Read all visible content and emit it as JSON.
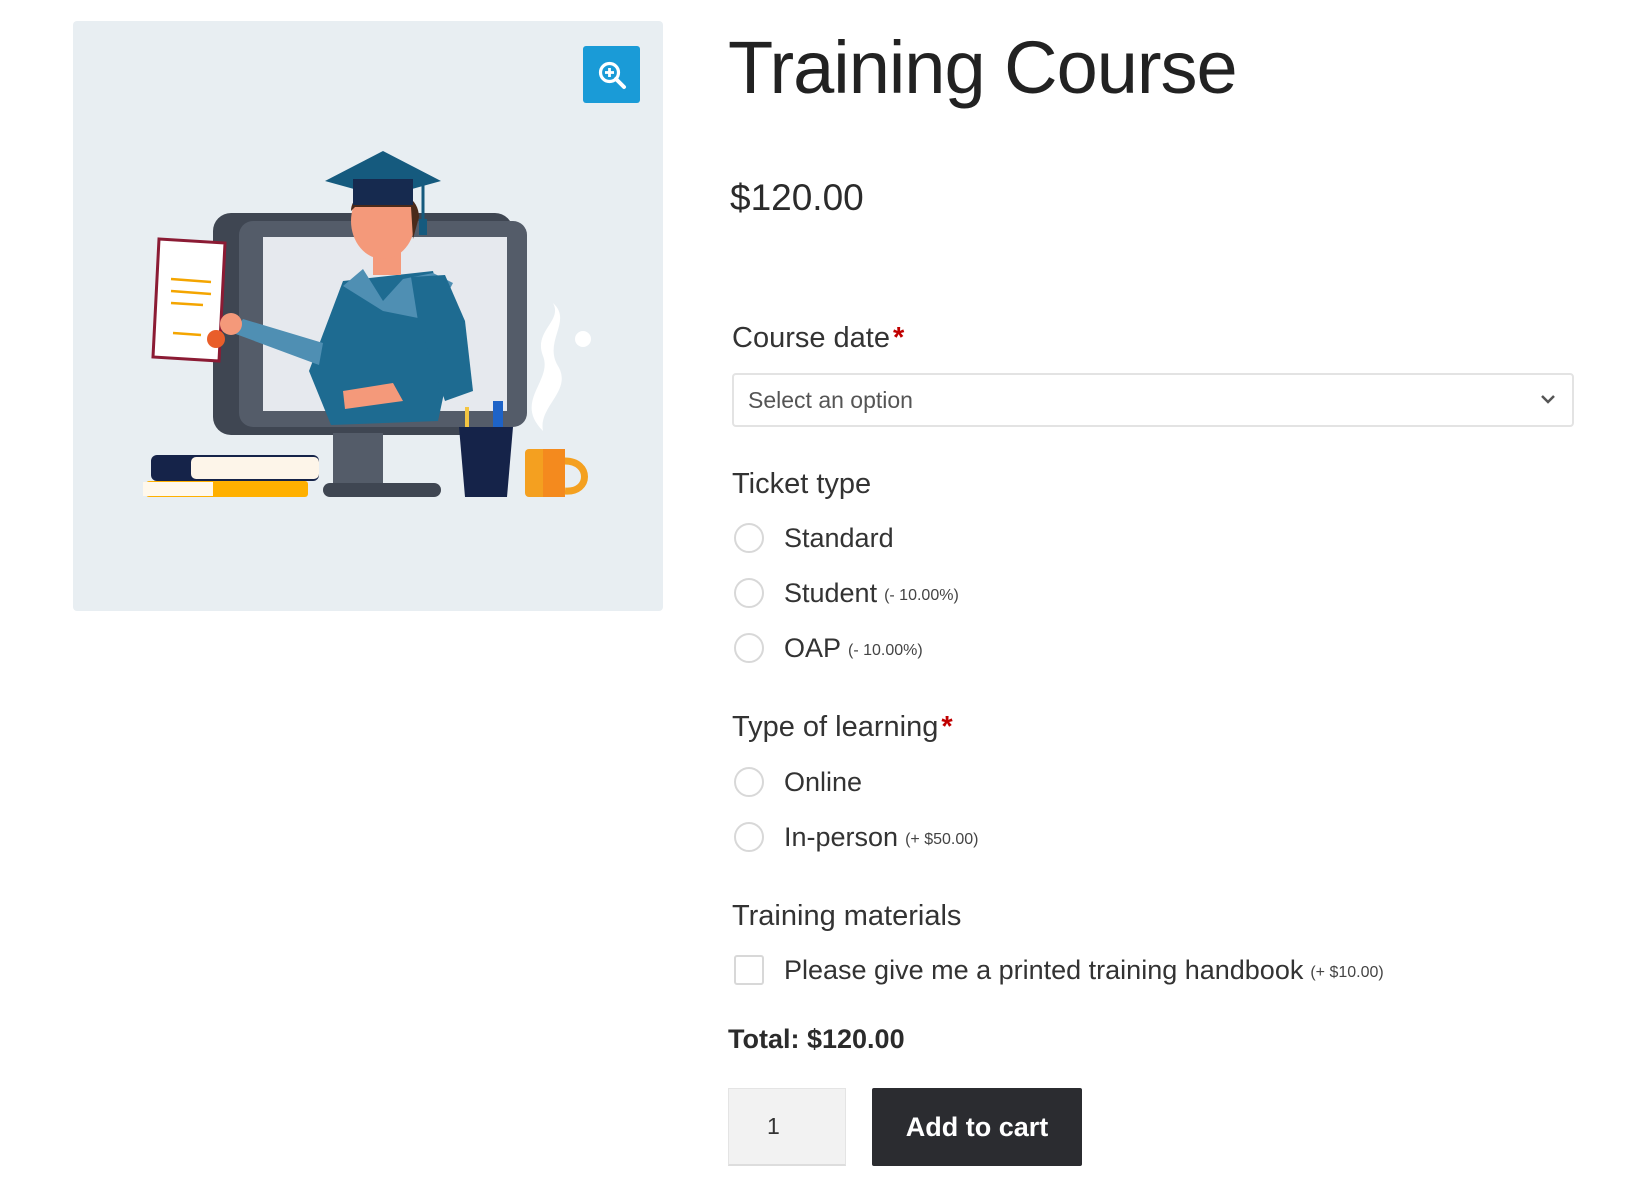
{
  "product": {
    "zoom_icon": "magnifier-plus-icon",
    "title": "Training Course",
    "price": "$120.00"
  },
  "course_date": {
    "label": "Course date",
    "required_mark": "*",
    "selected": "Select an option",
    "chevron_icon": "chevron-down-icon"
  },
  "ticket_type": {
    "label": "Ticket type",
    "options": [
      {
        "label": "Standard",
        "adjustment": ""
      },
      {
        "label": "Student",
        "adjustment": "(- 10.00%)"
      },
      {
        "label": "OAP",
        "adjustment": "(- 10.00%)"
      }
    ]
  },
  "learning_type": {
    "label": "Type of learning",
    "required_mark": "*",
    "options": [
      {
        "label": "Online",
        "adjustment": ""
      },
      {
        "label": "In-person",
        "adjustment": "(+ $50.00)"
      }
    ]
  },
  "training_materials": {
    "label": "Training materials",
    "checkbox_label": "Please give me a printed training handbook",
    "adjustment": "(+ $10.00)"
  },
  "total": "Total: $120.00",
  "cart": {
    "quantity": "1",
    "add_label": "Add to cart"
  },
  "colors": {
    "accent": "#1a9bd7",
    "required": "#c00000",
    "button_bg": "#2b2c30"
  }
}
